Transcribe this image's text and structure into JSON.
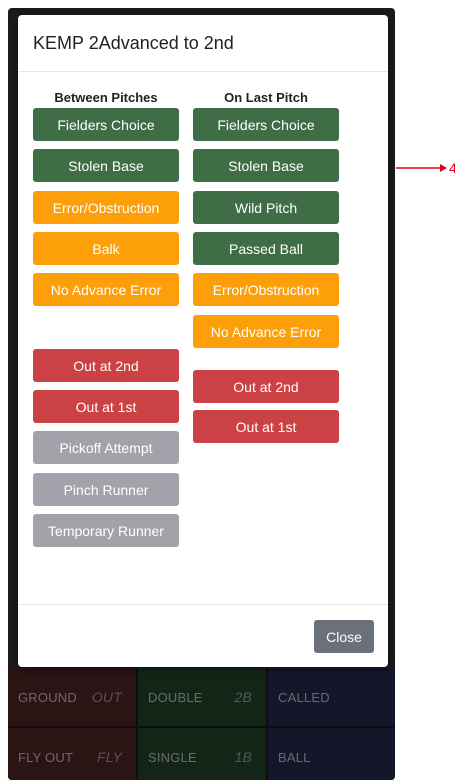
{
  "modal": {
    "title": "KEMP 2Advanced to 2nd",
    "close_label": "Close"
  },
  "between_pitches": {
    "title": "Between Pitches",
    "buttons": [
      "Fielders Choice",
      "Stolen Base",
      "Error/Obstruction",
      "Balk",
      "No Advance Error",
      "Out at 2nd",
      "Out at 1st",
      "Pickoff Attempt",
      "Pinch Runner",
      "Temporary Runner"
    ]
  },
  "on_last_pitch": {
    "title": "On Last Pitch",
    "buttons": [
      "Fielders Choice",
      "Stolen Base",
      "Wild Pitch",
      "Passed Ball",
      "Error/Obstruction",
      "No Advance Error",
      "Out at 2nd",
      "Out at 1st"
    ]
  },
  "background_grid": {
    "cells": [
      {
        "label": "GROUND",
        "glyph": "OUT"
      },
      {
        "label": "DOUBLE",
        "glyph": "2B"
      },
      {
        "label": "CALLED",
        "glyph": ""
      },
      {
        "label": "FLY OUT",
        "glyph": "FLY"
      },
      {
        "label": "SINGLE",
        "glyph": "1B"
      },
      {
        "label": "BALL",
        "glyph": ""
      }
    ]
  },
  "annotation": {
    "label": "4"
  },
  "colors": {
    "green": "#3f6d45",
    "orange": "#fd9f08",
    "red": "#cc4143",
    "gray": "#a3a2ab",
    "close": "#6b7178",
    "arrow": "#e0001b"
  }
}
